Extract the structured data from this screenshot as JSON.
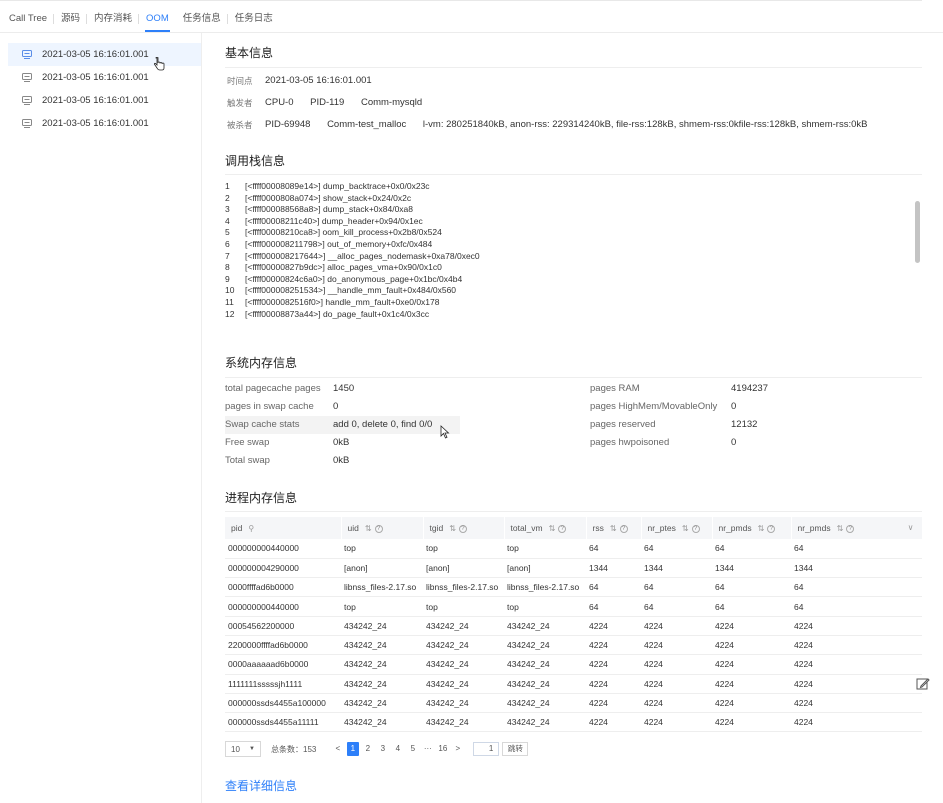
{
  "tabs": [
    "Call Tree",
    "源码",
    "内存消耗",
    "OOM",
    "任务信息",
    "任务日志"
  ],
  "active_tab": "OOM",
  "left_list": [
    "2021-03-05 16:16:01.001",
    "2021-03-05 16:16:01.001",
    "2021-03-05 16:16:01.001",
    "2021-03-05 16:16:01.001"
  ],
  "basic": {
    "title": "基本信息",
    "time_key": "时间点",
    "time_val": "2021-03-05 16:16:01.001",
    "trigger_key": "触发者",
    "trigger_vals": [
      "CPU-0",
      "PID-119",
      "Comm-mysqld"
    ],
    "killed_key": "被杀者",
    "killed_vals": [
      "PID-69948",
      "Comm-test_malloc",
      "l-vm: 280251840kB, anon-rss: 229314240kB, file-rss:128kB, shmem-rss:0kfile-rss:128kB, shmem-rss:0kB"
    ]
  },
  "stack": {
    "title": "调用栈信息",
    "rows": [
      {
        "n": "1",
        "t": "[<ffff00008089e14>] dump_backtrace+0x0/0x23c"
      },
      {
        "n": "2",
        "t": "[<ffff0000808a074>] show_stack+0x24/0x2c"
      },
      {
        "n": "3",
        "t": "[<ffff000088568a8>] dump_stack+0x84/0xa8"
      },
      {
        "n": "4",
        "t": "[<ffff00008211c40>] dump_header+0x94/0x1ec"
      },
      {
        "n": "5",
        "t": "[<ffff00008210ca8>] oom_kill_process+0x2b8/0x524"
      },
      {
        "n": "6",
        "t": "[<ffff000008211798>] out_of_memory+0xfc/0x484"
      },
      {
        "n": "7",
        "t": "[<ffff000008217644>] __alloc_pages_nodemask+0xa78/0xec0"
      },
      {
        "n": "8",
        "t": "[<ffff00000827b9dc>] alloc_pages_vma+0x90/0x1c0"
      },
      {
        "n": "9",
        "t": "[<ffff00000824c6a0>] do_anonymous_page+0x1bc/0x4b4"
      },
      {
        "n": "10",
        "t": "[<ffff000008251534>] __handle_mm_fault+0x484/0x560"
      },
      {
        "n": "11",
        "t": "[<ffff0000082516f0>] handle_mm_fault+0xe0/0x178"
      },
      {
        "n": "12",
        "t": "[<ffff00008873a44>] do_page_fault+0x1c4/0x3cc"
      }
    ]
  },
  "sysmem": {
    "title": "系统内存信息",
    "left": [
      {
        "k": "total pagecache pages",
        "v": "1450"
      },
      {
        "k": "pages in swap cache",
        "v": "0"
      },
      {
        "k": "Swap cache stats",
        "v": "add 0, delete 0, find 0/0"
      },
      {
        "k": "Free swap",
        "v": "0kB"
      },
      {
        "k": "Total swap",
        "v": "0kB"
      }
    ],
    "right": [
      {
        "k": "pages RAM",
        "v": "4194237"
      },
      {
        "k": "pages HighMem/MovableOnly",
        "v": "0"
      },
      {
        "k": "pages reserved",
        "v": "12132"
      },
      {
        "k": "pages hwpoisoned",
        "v": "0"
      }
    ]
  },
  "procmem": {
    "title": "进程内存信息",
    "columns": [
      "pid",
      "uid",
      "tgid",
      "total_vm",
      "rss",
      "nr_ptes",
      "nr_pmds",
      "nr_pmds"
    ],
    "rows": [
      [
        "000000000440000",
        "top",
        "top",
        "top",
        "64",
        "64",
        "64",
        "64"
      ],
      [
        "000000004290000",
        "[anon]",
        "[anon]",
        "[anon]",
        "1344",
        "1344",
        "1344",
        "1344"
      ],
      [
        "0000ffffad6b0000",
        "libnss_files-2.17.so",
        "libnss_files-2.17.so",
        "libnss_files-2.17.so",
        "64",
        "64",
        "64",
        "64"
      ],
      [
        "000000000440000",
        "top",
        "top",
        "top",
        "64",
        "64",
        "64",
        "64"
      ],
      [
        "00054562200000",
        "434242_24",
        "434242_24",
        "434242_24",
        "4224",
        "4224",
        "4224",
        "4224"
      ],
      [
        "2200000ffffad6b0000",
        "434242_24",
        "434242_24",
        "434242_24",
        "4224",
        "4224",
        "4224",
        "4224"
      ],
      [
        "0000aaaaaad6b0000",
        "434242_24",
        "434242_24",
        "434242_24",
        "4224",
        "4224",
        "4224",
        "4224"
      ],
      [
        "1111111sssssjh1111",
        "434242_24",
        "434242_24",
        "434242_24",
        "4224",
        "4224",
        "4224",
        "4224"
      ],
      [
        "000000ssds4455a100000",
        "434242_24",
        "434242_24",
        "434242_24",
        "4224",
        "4224",
        "4224",
        "4224"
      ],
      [
        "000000ssds4455a11111",
        "434242_24",
        "434242_24",
        "434242_24",
        "4224",
        "4224",
        "4224",
        "4224"
      ]
    ]
  },
  "pager": {
    "size": "10",
    "total": "总条数：153",
    "prev": "<",
    "pages": [
      "1",
      "2",
      "3",
      "4",
      "5",
      "···",
      "16"
    ],
    "active_page": "1",
    "next": ">",
    "jump_value": "1",
    "jump_label": "跳转"
  },
  "detail_link": "查看详细信息",
  "colors": {
    "accent": "#2d7ff9",
    "active_bg": "#eef5ff"
  }
}
